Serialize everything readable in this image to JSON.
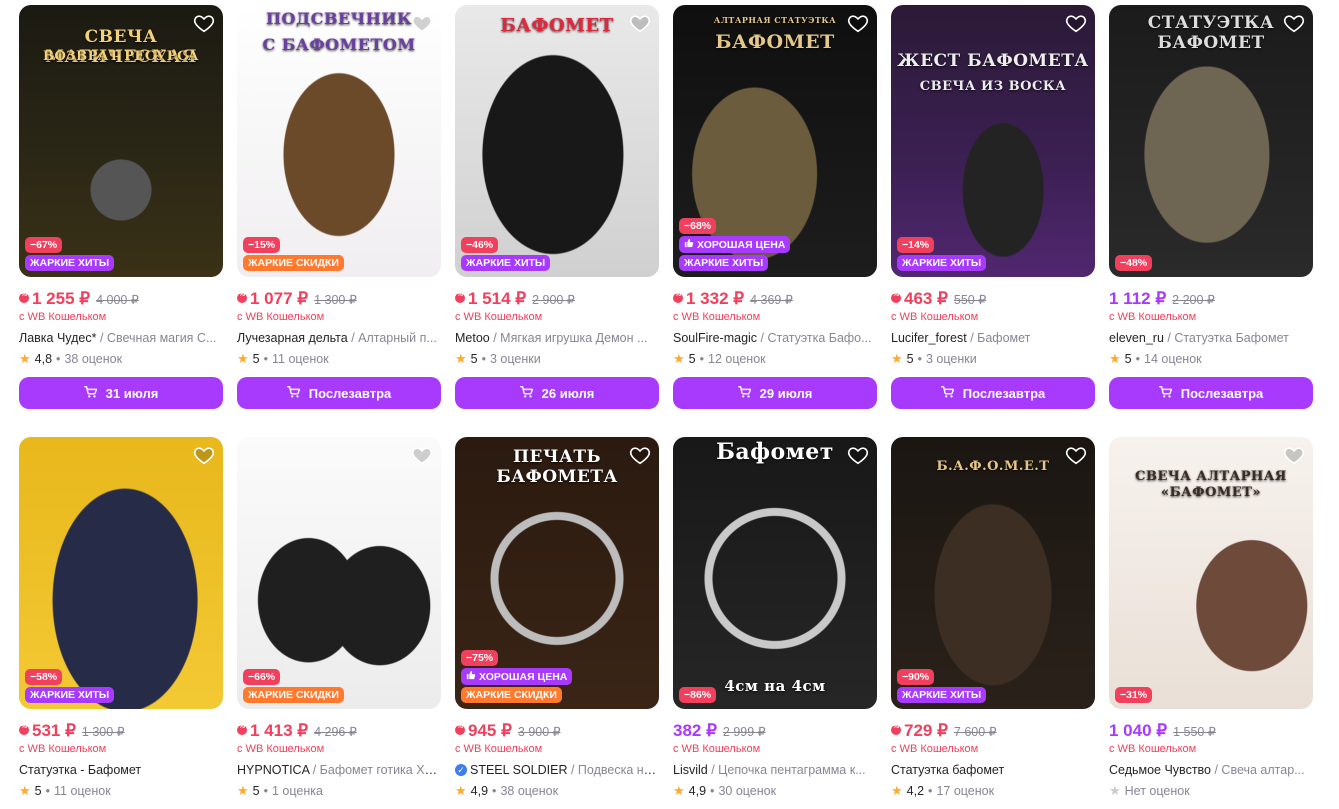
{
  "products": [
    {
      "discount": "−67%",
      "badges": [
        "ЖАРКИЕ ХИТЫ"
      ],
      "badge_kinds": [
        "hot"
      ],
      "price": "1 255 ₽",
      "old_price": "4 000 ₽",
      "wallet": "с WB Кошельком",
      "brand": "Лавка Чудес*",
      "desc": " / Свечная магия С...",
      "rating": "4,8",
      "reviews": "38 оценок",
      "button": "31 июля",
      "overlay": [
        "СВЕЧА МАГИЧЕСКАЯ",
        "ВОЗВРАТ РЕСУРСА"
      ],
      "price_color": "red",
      "wb_icon": true,
      "verified": false
    },
    {
      "discount": "−15%",
      "badges": [
        "ЖАРКИЕ СКИДКИ"
      ],
      "badge_kinds": [
        "sale"
      ],
      "price": "1 077 ₽",
      "old_price": "1 300 ₽",
      "wallet": "с WB Кошельком",
      "brand": "Лучезарная дельта",
      "desc": " / Алтарный п...",
      "rating": "5",
      "reviews": "11 оценок",
      "button": "Послезавтра",
      "overlay": [
        "ПОДСВЕЧНИК",
        "С БАФОМЕТОМ"
      ],
      "price_color": "red",
      "wb_icon": true,
      "verified": false
    },
    {
      "discount": "−46%",
      "badges": [
        "ЖАРКИЕ ХИТЫ"
      ],
      "badge_kinds": [
        "hot"
      ],
      "price": "1 514 ₽",
      "old_price": "2 900 ₽",
      "wallet": "с WB Кошельком",
      "brand": "Metoo",
      "desc": " / Мягкая игрушка Демон ...",
      "rating": "5",
      "reviews": "3 оценки",
      "button": "26 июля",
      "overlay": [
        "БАФОМЕТ"
      ],
      "price_color": "red",
      "wb_icon": true,
      "verified": false
    },
    {
      "discount": "−68%",
      "badges": [
        "ХОРОШАЯ ЦЕНА",
        "ЖАРКИЕ ХИТЫ"
      ],
      "badge_kinds": [
        "good",
        "hot"
      ],
      "price": "1 332 ₽",
      "old_price": "4 369 ₽",
      "wallet": "с WB Кошельком",
      "brand": "SoulFire-magic",
      "desc": " / Статуэтка Бафо...",
      "rating": "5",
      "reviews": "12 оценок",
      "button": "29 июля",
      "overlay": [
        "АЛТАРНАЯ СТАТУЭТКА",
        "БАФОМЕТ"
      ],
      "price_color": "red",
      "wb_icon": true,
      "verified": false
    },
    {
      "discount": "−14%",
      "badges": [
        "ЖАРКИЕ ХИТЫ"
      ],
      "badge_kinds": [
        "hot"
      ],
      "price": "463 ₽",
      "old_price": "550 ₽",
      "wallet": "с WB Кошельком",
      "brand": "Lucifer_forest",
      "desc": " / Бафомет",
      "rating": "5",
      "reviews": "3 оценки",
      "button": "Послезавтра",
      "overlay": [
        "ЖЕСТ БАФОМЕТА",
        "СВЕЧА ИЗ ВОСКА"
      ],
      "price_color": "red",
      "wb_icon": true,
      "verified": false
    },
    {
      "discount": "−48%",
      "badges": [],
      "badge_kinds": [],
      "price": "1 112 ₽",
      "old_price": "2 200 ₽",
      "wallet": "с WB Кошельком",
      "brand": "eleven_ru",
      "desc": " / Статуэтка Бафомет",
      "rating": "5",
      "reviews": "14 оценок",
      "button": "Послезавтра",
      "overlay": [
        "СТАТУЭТКА БАФОМЕТ"
      ],
      "price_color": "purple",
      "wb_icon": false,
      "verified": false
    },
    {
      "discount": "−58%",
      "badges": [
        "ЖАРКИЕ ХИТЫ"
      ],
      "badge_kinds": [
        "hot"
      ],
      "price": "531 ₽",
      "old_price": "1 300 ₽",
      "wallet": "с WB Кошельком",
      "brand": "Статуэтка - Бафомет",
      "desc": "",
      "rating": "5",
      "reviews": "11 оценок",
      "button": "",
      "overlay": [],
      "price_color": "red",
      "wb_icon": true,
      "verified": false
    },
    {
      "discount": "−66%",
      "badges": [
        "ЖАРКИЕ СКИДКИ"
      ],
      "badge_kinds": [
        "sale"
      ],
      "price": "1 413 ₽",
      "old_price": "4 296 ₽",
      "wallet": "с WB Кошельком",
      "brand": "HYPNOTICA",
      "desc": " / Бафомет готика Хэ...",
      "rating": "5",
      "reviews": "1 оценка",
      "button": "",
      "overlay": [],
      "price_color": "red",
      "wb_icon": true,
      "verified": false
    },
    {
      "discount": "−75%",
      "badges": [
        "ХОРОШАЯ ЦЕНА",
        "ЖАРКИЕ СКИДКИ"
      ],
      "badge_kinds": [
        "good",
        "sale"
      ],
      "price": "945 ₽",
      "old_price": "3 900 ₽",
      "wallet": "с WB Кошельком",
      "brand": "STEEL SOLDIER",
      "desc": " / Подвеска на ...",
      "rating": "4,9",
      "reviews": "38 оценок",
      "button": "",
      "overlay": [
        "ПЕЧАТЬ БАФОМЕТА"
      ],
      "price_color": "red",
      "wb_icon": true,
      "verified": true
    },
    {
      "discount": "−86%",
      "badges": [],
      "badge_kinds": [],
      "price": "382 ₽",
      "old_price": "2 999 ₽",
      "wallet": "с WB Кошельком",
      "brand": "Lisvild",
      "desc": " / Цепочка пентаграмма к...",
      "rating": "4,9",
      "reviews": "30 оценок",
      "button": "",
      "overlay": [
        "Бафомет",
        "4см на 4см"
      ],
      "price_color": "purple",
      "wb_icon": false,
      "verified": false
    },
    {
      "discount": "−90%",
      "badges": [
        "ЖАРКИЕ ХИТЫ"
      ],
      "badge_kinds": [
        "hot"
      ],
      "price": "729 ₽",
      "old_price": "7 600 ₽",
      "wallet": "с WB Кошельком",
      "brand": "Статуэтка бафомет",
      "desc": "",
      "rating": "4,2",
      "reviews": "17 оценок",
      "button": "",
      "overlay": [
        "Б.А.Ф.О.М.Е.Т"
      ],
      "price_color": "red",
      "wb_icon": true,
      "verified": false
    },
    {
      "discount": "−31%",
      "badges": [],
      "badge_kinds": [],
      "price": "1 040 ₽",
      "old_price": "1 550 ₽",
      "wallet": "с WB Кошельком",
      "brand": "Седьмое Чувство",
      "desc": " / Свеча алтар...",
      "rating": "",
      "reviews": "Нет оценок",
      "button": "",
      "overlay": [
        "СВЕЧА АЛТАРНАЯ",
        "«БАФОМЕТ»"
      ],
      "price_color": "purple",
      "wb_icon": false,
      "verified": false
    }
  ],
  "colors": {
    "accent": "#a73afd",
    "sale_red": "#f0405d",
    "star": "#ffa930"
  },
  "icons": {
    "favorite": "heart-icon",
    "cart": "cart-icon",
    "star": "star-icon"
  }
}
